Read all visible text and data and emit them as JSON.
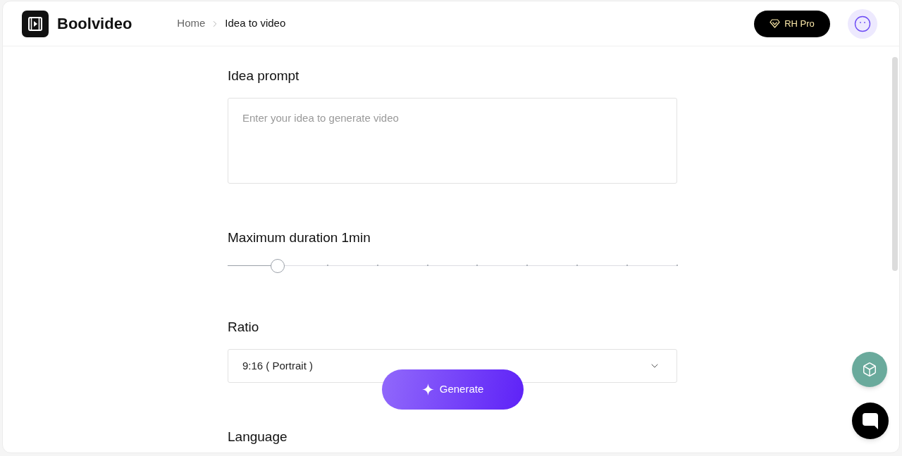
{
  "header": {
    "logo": "Boolvideo",
    "breadcrumb": [
      {
        "label": "Home",
        "selected": false
      },
      {
        "label": "Idea to video",
        "selected": true
      }
    ],
    "pro_button": "RH Pro"
  },
  "form": {
    "prompt": {
      "label": "Idea prompt",
      "placeholder": "Enter your idea to generate video"
    },
    "duration": {
      "label": "Maximum duration 1min",
      "level": 0.111
    },
    "ratio": {
      "label": "Ratio",
      "value": "9:16 ( Portrait )"
    },
    "language": {
      "label": "Language"
    }
  },
  "generate_button": {
    "label": "Generate"
  }
}
